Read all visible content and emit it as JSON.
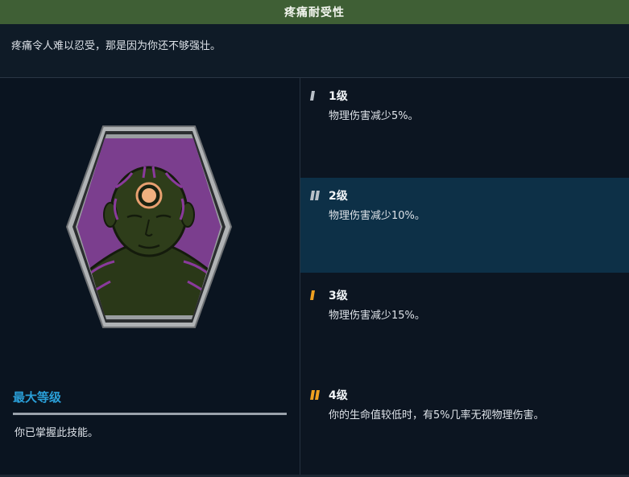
{
  "header": {
    "title": "疼痛耐受性"
  },
  "skill": {
    "description": "疼痛令人难以忍受，那是因为你还不够强壮。",
    "icon": "pain-tolerance-head-icon"
  },
  "max_level": {
    "label": "最大等级",
    "status_text": "你已掌握此技能。"
  },
  "levels": [
    {
      "label": "1级",
      "description": "物理伤害减少5%。",
      "pips": 1,
      "pip_color": "#b9c0c8",
      "highlighted": false
    },
    {
      "label": "2级",
      "description": "物理伤害减少10%。",
      "pips": 2,
      "pip_color": "#b9c0c8",
      "highlighted": true
    },
    {
      "label": "3级",
      "description": "物理伤害减少15%。",
      "pips": 1,
      "pip_color": "#f0a020",
      "highlighted": false
    },
    {
      "label": "4级",
      "description": "你的生命值较低时，有5%几率无视物理伤害。",
      "pips": 2,
      "pip_color": "#f0a020",
      "highlighted": false
    }
  ],
  "colors": {
    "title_bar": "#3f5f35",
    "highlight_row": "#0d3047",
    "accent_blue": "#2a9fd8",
    "accent_orange": "#f0a020"
  }
}
